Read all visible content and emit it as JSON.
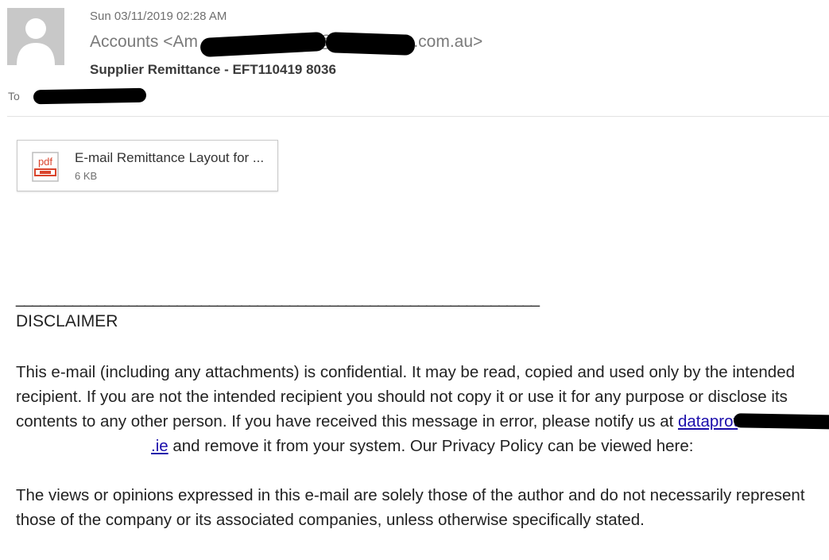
{
  "header": {
    "date": "Sun 03/11/2019 02:28 AM",
    "from_prefix": "Accounts <Am",
    "from_mid": "@",
    "from_suffix": ".com.au>",
    "subject": "Supplier Remittance - EFT110419 8036",
    "to_label": "To"
  },
  "attachment": {
    "icon": "pdf-icon",
    "name": "E-mail Remittance Layout for ...",
    "size": "6 KB",
    "icon_text": "pdf"
  },
  "body": {
    "signature_line": "_________________________________________________________________",
    "disclaimer_title": "DISCLAIMER",
    "paragraph1_a": "This e-mail (including any attachments) is confidential. It may be read, copied and used only by the intended recipient. If you are not the intended recipient you should not copy it or use it for any purpose or disclose its contents to any other person.  If you have received this message in error, please notify us at ",
    "link_prefix": "dataprot",
    "link_suffix": ".ie",
    "paragraph1_b": " and remove it from your system. Our Privacy Policy can be viewed here:",
    "paragraph2": "The views or opinions expressed in this e-mail are solely those of the author and do not necessarily represent those of the company or its associated companies, unless otherwise specifically stated."
  },
  "colors": {
    "link": "#1a0dab",
    "avatar_bg": "#c8c8c8",
    "pdf_red": "#d9442c"
  }
}
